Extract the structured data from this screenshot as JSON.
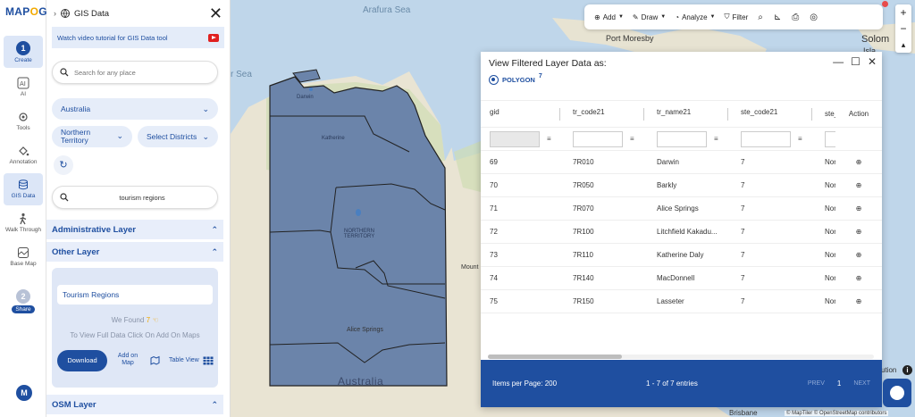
{
  "logo": {
    "text_a": "MAP",
    "text_b": "O",
    "text_c": "G"
  },
  "rail": {
    "create": {
      "step": "1",
      "label": "Create"
    },
    "ai": {
      "label": "AI"
    },
    "tools": {
      "label": "Tools"
    },
    "annotation": {
      "label": "Annotation"
    },
    "gis_data": {
      "label": "GIS Data"
    },
    "walk_through": {
      "label": "Walk Through"
    },
    "base_map": {
      "label": "Base Map"
    },
    "share": {
      "step": "2",
      "label": "Share"
    },
    "user_initial": "M"
  },
  "panel": {
    "title": "GIS Data",
    "video_tutorial": "Watch video tutorial for GIS Data tool",
    "place_search_placeholder": "Search for any place",
    "country": "Australia",
    "state": "Northern Territory",
    "districts": "Select Districts",
    "layer_search_value": "tourism regions",
    "administrative_layer": "Administrative Layer",
    "other_layer": "Other Layer",
    "osm_layer": "OSM Layer",
    "tourism_card": {
      "name": "Tourism Regions",
      "found": "We Found",
      "found_count": "7",
      "instruction": "To View Full Data Click On Add On Maps",
      "download": "Download",
      "add_on_map": "Add on Map",
      "table_view": "Table View"
    }
  },
  "toolbar": {
    "add": "Add",
    "draw": "Draw",
    "analyze": "Analyze",
    "filter": "Filter"
  },
  "map_labels": {
    "arafura_sea": "Arafura Sea",
    "port_moresby": "Port Moresby",
    "solomon": "Solom",
    "solomon2": "Isla",
    "timor_sea": "r Sea",
    "darwin": "Darwin",
    "katherine": "Katherine",
    "northern_territory": "NORTHERN TERRITORY",
    "alice_springs": "Alice Springs",
    "australia": "Australia",
    "mount": "Mount",
    "brisbane": "Brisbane",
    "ution": "ution",
    "attribution": "© MapTiler © OpenStreetMap contributors"
  },
  "dialog": {
    "title": "View Filtered Layer Data as:",
    "geometry": "POLYGON",
    "count": "7",
    "columns": [
      "gid",
      "tr_code21",
      "tr_name21",
      "ste_code21",
      "ste_n",
      "Action"
    ],
    "rows": [
      [
        "69",
        "7R010",
        "Darwin",
        "7",
        "Nort"
      ],
      [
        "70",
        "7R050",
        "Barkly",
        "7",
        "Nort"
      ],
      [
        "71",
        "7R070",
        "Alice Springs",
        "7",
        "Nort"
      ],
      [
        "72",
        "7R100",
        "Litchfield Kakadu...",
        "7",
        "Nort"
      ],
      [
        "73",
        "7R110",
        "Katherine Daly",
        "7",
        "Nort"
      ],
      [
        "74",
        "7R140",
        "MacDonnell",
        "7",
        "Nort"
      ],
      [
        "75",
        "7R150",
        "Lasseter",
        "7",
        "Nort"
      ]
    ],
    "items_per_page": "Items per Page: 200",
    "range": "1 - 7 of 7 entries",
    "prev": "PREV",
    "page": "1",
    "next": "NEXT"
  }
}
